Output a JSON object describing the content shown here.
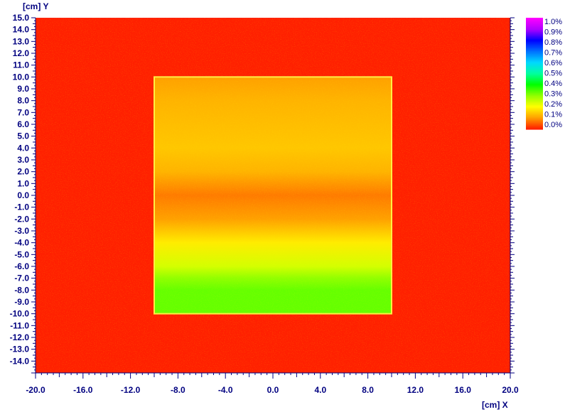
{
  "chart_data": {
    "type": "heatmap",
    "title": "",
    "xlabel": "[cm] X",
    "ylabel": "[cm] Y",
    "xlim": [
      -20.0,
      20.0
    ],
    "ylim": [
      -15.0,
      15.0
    ],
    "x_ticks": [
      "-20.0",
      "-16.0",
      "-12.0",
      "-8.0",
      "-4.0",
      "0.0",
      "4.0",
      "8.0",
      "12.0",
      "16.0",
      "20.0"
    ],
    "y_ticks": [
      "15.0",
      "14.0",
      "13.0",
      "12.0",
      "11.0",
      "10.0",
      "9.0",
      "8.0",
      "7.0",
      "6.0",
      "5.0",
      "4.0",
      "3.0",
      "2.0",
      "1.0",
      "0.0",
      "-1.0",
      "-2.0",
      "-3.0",
      "-4.0",
      "-5.0",
      "-6.0",
      "-7.0",
      "-8.0",
      "-9.0",
      "-10.0",
      "-11.0",
      "-12.0",
      "-13.0",
      "-14.0"
    ],
    "field": {
      "x": [
        -10.0,
        10.0
      ],
      "y": [
        -10.0,
        10.0
      ],
      "background_value": 0.0
    },
    "y_profile": [
      {
        "y": 10.0,
        "value": 0.1
      },
      {
        "y": 8.0,
        "value": 0.12
      },
      {
        "y": 6.0,
        "value": 0.13
      },
      {
        "y": 4.0,
        "value": 0.14
      },
      {
        "y": 2.0,
        "value": 0.12
      },
      {
        "y": 0.0,
        "value": 0.07
      },
      {
        "y": -2.0,
        "value": 0.1
      },
      {
        "y": -4.0,
        "value": 0.18
      },
      {
        "y": -6.0,
        "value": 0.24
      },
      {
        "y": -7.0,
        "value": 0.3
      },
      {
        "y": -8.0,
        "value": 0.33
      },
      {
        "y": -10.0,
        "value": 0.33
      }
    ],
    "colorbar": {
      "unit": "%",
      "labels": [
        "1.0%",
        "0.9%",
        "0.8%",
        "0.7%",
        "0.6%",
        "0.5%",
        "0.4%",
        "0.3%",
        "0.2%",
        "0.1%",
        "0.0%"
      ],
      "colors": [
        "#ff00ff",
        "#b000ff",
        "#0000ff",
        "#0070ff",
        "#00d8ff",
        "#00ffa0",
        "#00ff00",
        "#90ff00",
        "#ffff00",
        "#ffa000",
        "#ff2000"
      ]
    },
    "grid": false,
    "legend": "right"
  }
}
